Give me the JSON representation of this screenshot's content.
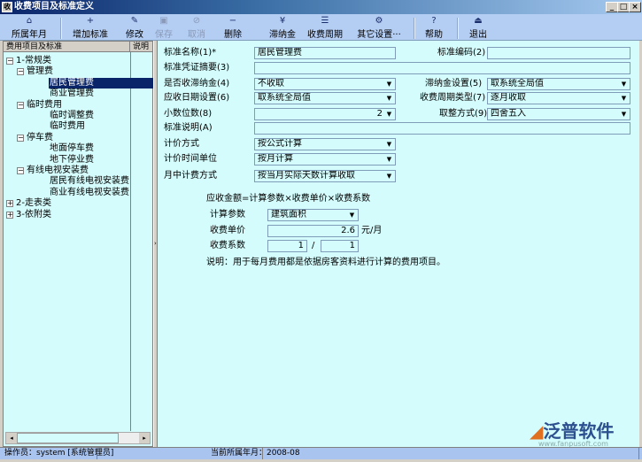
{
  "window": {
    "title": "收费项目及标准定义",
    "min": "_",
    "max": "□",
    "close": "×"
  },
  "toolbar": [
    {
      "label": "所属年月",
      "icon": "calendar-icon",
      "glyph": "⌂"
    },
    {
      "label": "增加标准",
      "icon": "add-icon",
      "glyph": "+"
    },
    {
      "label": "修改",
      "icon": "edit-icon",
      "glyph": "✎"
    },
    {
      "label": "保存",
      "icon": "save-icon",
      "glyph": "▣",
      "disabled": true
    },
    {
      "label": "取消",
      "icon": "cancel-icon",
      "glyph": "⊘",
      "disabled": true
    },
    {
      "label": "删除",
      "icon": "delete-icon",
      "glyph": "−"
    },
    {
      "label": "滞纳金",
      "icon": "late-fee-icon",
      "glyph": "¥"
    },
    {
      "label": "收费周期",
      "icon": "cycle-icon",
      "glyph": "☰"
    },
    {
      "label": "其它设置···",
      "icon": "settings-icon",
      "glyph": "⚙"
    },
    {
      "label": "帮助",
      "icon": "help-icon",
      "glyph": "?"
    },
    {
      "label": "退出",
      "icon": "exit-icon",
      "glyph": "⏏"
    }
  ],
  "tree": {
    "col1": "费用项目及标准",
    "col2": "说明",
    "items": [
      {
        "label": "1-常规类",
        "level": 0,
        "exp": "−"
      },
      {
        "label": "管理费",
        "level": 1,
        "exp": "−"
      },
      {
        "label": "居民管理费",
        "level": 2,
        "selected": true
      },
      {
        "label": "商业管理费",
        "level": 2
      },
      {
        "label": "临时费用",
        "level": 1,
        "exp": "−"
      },
      {
        "label": "临时调整费",
        "level": 2
      },
      {
        "label": "临时费用",
        "level": 2
      },
      {
        "label": "停车费",
        "level": 1,
        "exp": "−"
      },
      {
        "label": "地面停车费",
        "level": 2
      },
      {
        "label": "地下停业费",
        "level": 2
      },
      {
        "label": "有线电视安装费",
        "level": 1,
        "exp": "−"
      },
      {
        "label": "居民有线电视安装费",
        "level": 2
      },
      {
        "label": "商业有线电视安装费",
        "level": 2
      },
      {
        "label": "2-走表类",
        "level": 0,
        "exp": "+"
      },
      {
        "label": "3-依附类",
        "level": 0,
        "exp": "+"
      }
    ]
  },
  "form": {
    "name_label": "标准名称(1)*",
    "name_value": "居民管理费",
    "code_label": "标准编码(2)",
    "code_value": "",
    "voucher_label": "标准凭证摘要(3)",
    "voucher_value": "",
    "latefee_label": "是否收滞纳金(4)",
    "latefee_value": "不收取",
    "latefee_set_label": "滞纳金设置(5)",
    "latefee_set_value": "取系统全局值",
    "duedate_label": "应收日期设置(6)",
    "duedate_value": "取系统全局值",
    "cycle_label": "收费周期类型(7)",
    "cycle_value": "逐月收取",
    "decimal_label": "小数位数(8)",
    "decimal_value": "2",
    "round_label": "取整方式(9)",
    "round_value": "四舍五入",
    "desc_label": "标准说明(A)",
    "desc_value": "",
    "pricing_label": "计价方式",
    "pricing_value": "按公式计算",
    "timeunit_label": "计价时间单位",
    "timeunit_value": "按月计算",
    "midmonth_label": "月中计费方式",
    "midmonth_value": "按当月实际天数计算收取"
  },
  "formula": {
    "text": "应收金额=计算参数×收费单价×收费系数",
    "param_label": "计算参数",
    "param_value": "建筑面积",
    "price_label": "收费单价",
    "price_value": "2.6",
    "price_unit": "元/月",
    "coef_label": "收费系数",
    "coef_num": "1",
    "coef_slash": "/",
    "coef_den": "1",
    "note": "说明：用于每月费用都是依据房客资料进行计算的费用项目。"
  },
  "status": {
    "operator": "操作员：system [系统管理员]",
    "period": "当前所属年月：2008-08"
  },
  "watermark": {
    "brand": "泛普软件",
    "url": "www.fanpusoft.com"
  }
}
